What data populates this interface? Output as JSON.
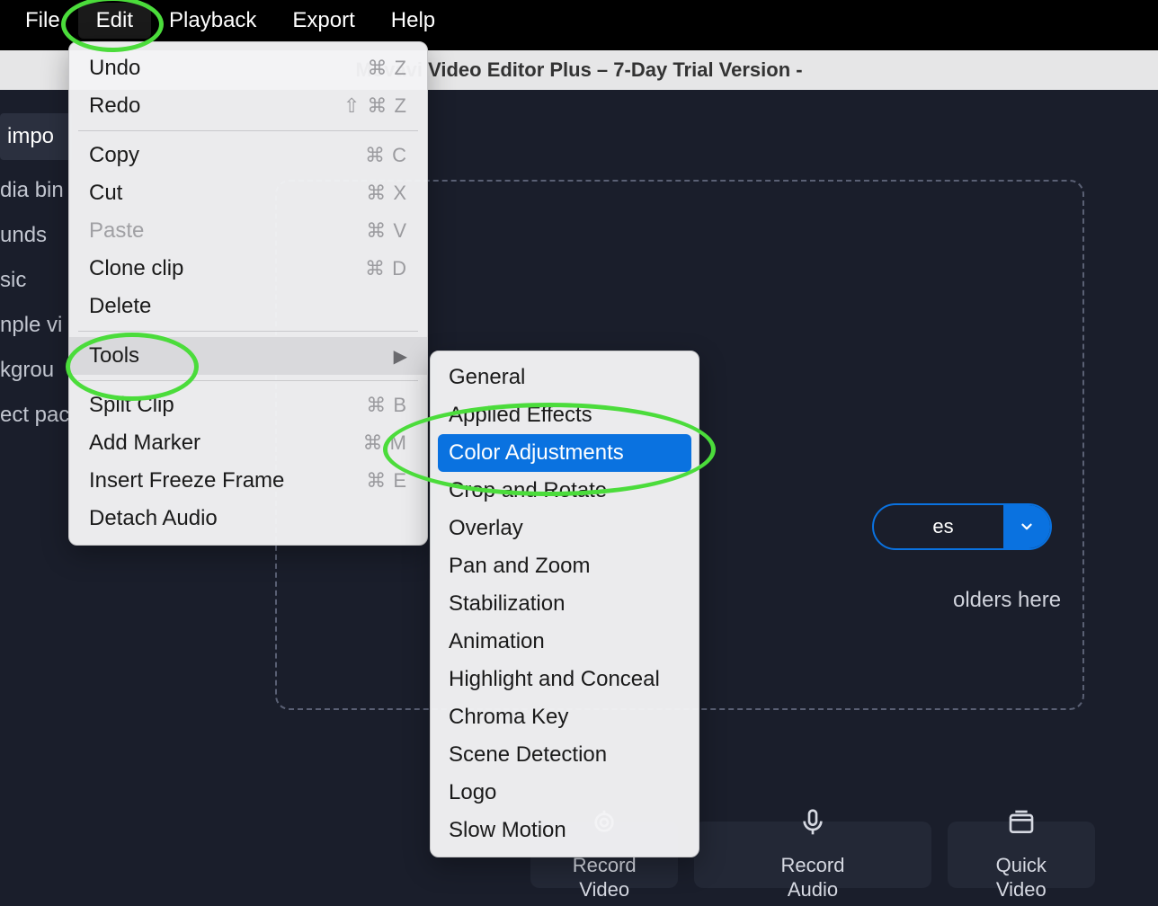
{
  "menubar": {
    "items": [
      {
        "label": "File"
      },
      {
        "label": "Edit",
        "active": true
      },
      {
        "label": "Playback"
      },
      {
        "label": "Export"
      },
      {
        "label": "Help"
      }
    ]
  },
  "titlebar": {
    "title": "Movavi Video Editor Plus – 7-Day Trial Version -"
  },
  "sidebar": {
    "tab": "impo",
    "items": [
      {
        "label": "dia bin"
      },
      {
        "label": "unds"
      },
      {
        "label": "sic"
      },
      {
        "label": "nple vi"
      },
      {
        "label": "kgrou"
      },
      {
        "label": "ect pac"
      }
    ]
  },
  "dropzone": {
    "add_files_label": "es",
    "hint_text": "olders here"
  },
  "tiles": [
    {
      "line1": "Record",
      "line2": "Video",
      "icon": "camera"
    },
    {
      "line1": "Record",
      "line2": "Audio",
      "icon": "mic"
    },
    {
      "line1": "Quick",
      "line2": "Video",
      "icon": "window"
    }
  ],
  "edit_menu": {
    "groups": [
      [
        {
          "label": "Undo",
          "shortcut": "⌘ Z"
        },
        {
          "label": "Redo",
          "shortcut": "⇧ ⌘ Z"
        }
      ],
      [
        {
          "label": "Copy",
          "shortcut": "⌘ C"
        },
        {
          "label": "Cut",
          "shortcut": "⌘ X"
        },
        {
          "label": "Paste",
          "shortcut": "⌘ V",
          "disabled": true
        },
        {
          "label": "Clone clip",
          "shortcut": "⌘ D"
        },
        {
          "label": "Delete",
          "shortcut": ""
        }
      ],
      [
        {
          "label": "Tools",
          "submenu": true,
          "highlighted": true
        }
      ],
      [
        {
          "label": "Split Clip",
          "shortcut": "⌘ B"
        },
        {
          "label": "Add Marker",
          "shortcut": "⌘ M"
        },
        {
          "label": "Insert Freeze Frame",
          "shortcut": "⌘ E"
        },
        {
          "label": "Detach Audio",
          "shortcut": ""
        }
      ]
    ]
  },
  "tools_submenu": {
    "items": [
      {
        "label": "General"
      },
      {
        "label": "Applied Effects"
      },
      {
        "label": "Color Adjustments",
        "selected": true
      },
      {
        "label": "Crop and Rotate"
      },
      {
        "label": "Overlay"
      },
      {
        "label": "Pan and Zoom"
      },
      {
        "label": "Stabilization"
      },
      {
        "label": "Animation"
      },
      {
        "label": "Highlight and Conceal"
      },
      {
        "label": "Chroma Key"
      },
      {
        "label": "Scene Detection"
      },
      {
        "label": "Logo"
      },
      {
        "label": "Slow Motion"
      }
    ]
  }
}
